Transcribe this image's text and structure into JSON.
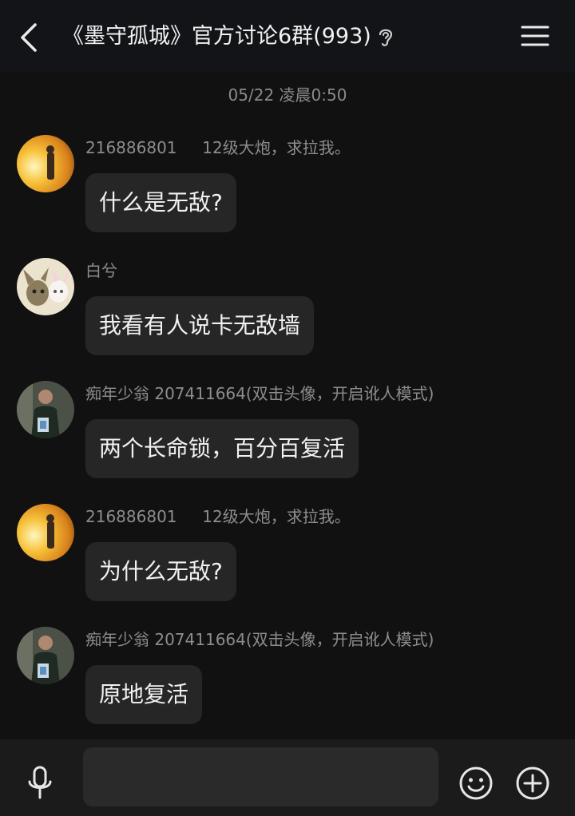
{
  "header": {
    "title": "《墨守孤城》官方讨论6群(993)",
    "back_icon": "back-arrow-icon",
    "ear_icon": "ear-icon",
    "menu_icon": "hamburger-menu-icon"
  },
  "chat": {
    "timestamp": "05/22 凌晨0:50",
    "messages": [
      {
        "sender": "216886801     12级大炮，求拉我。",
        "text": "什么是无敌?",
        "avatar": "avatar-sunset"
      },
      {
        "sender": "白兮",
        "text": "我看有人说卡无敌墙",
        "avatar": "avatar-anime-cats"
      },
      {
        "sender": "痴年少翁 207411664(双击头像，开启讹人模式)",
        "text": "两个长命锁，百分百复活",
        "avatar": "avatar-man"
      },
      {
        "sender": "216886801     12级大炮，求拉我。",
        "text": "为什么无敌?",
        "avatar": "avatar-sunset"
      },
      {
        "sender": "痴年少翁 207411664(双击头像，开启讹人模式)",
        "text": "原地复活",
        "avatar": "avatar-man"
      }
    ]
  },
  "input_bar": {
    "mic_icon": "microphone-icon",
    "input_value": "",
    "emoji_icon": "emoji-icon",
    "plus_icon": "plus-circle-icon"
  },
  "colors": {
    "background": "#111111",
    "header": "#131418",
    "bubble": "#262626",
    "input_bar": "#1b1b1b",
    "text_primary": "#f1f1f1",
    "text_secondary": "#8d8d8d"
  }
}
